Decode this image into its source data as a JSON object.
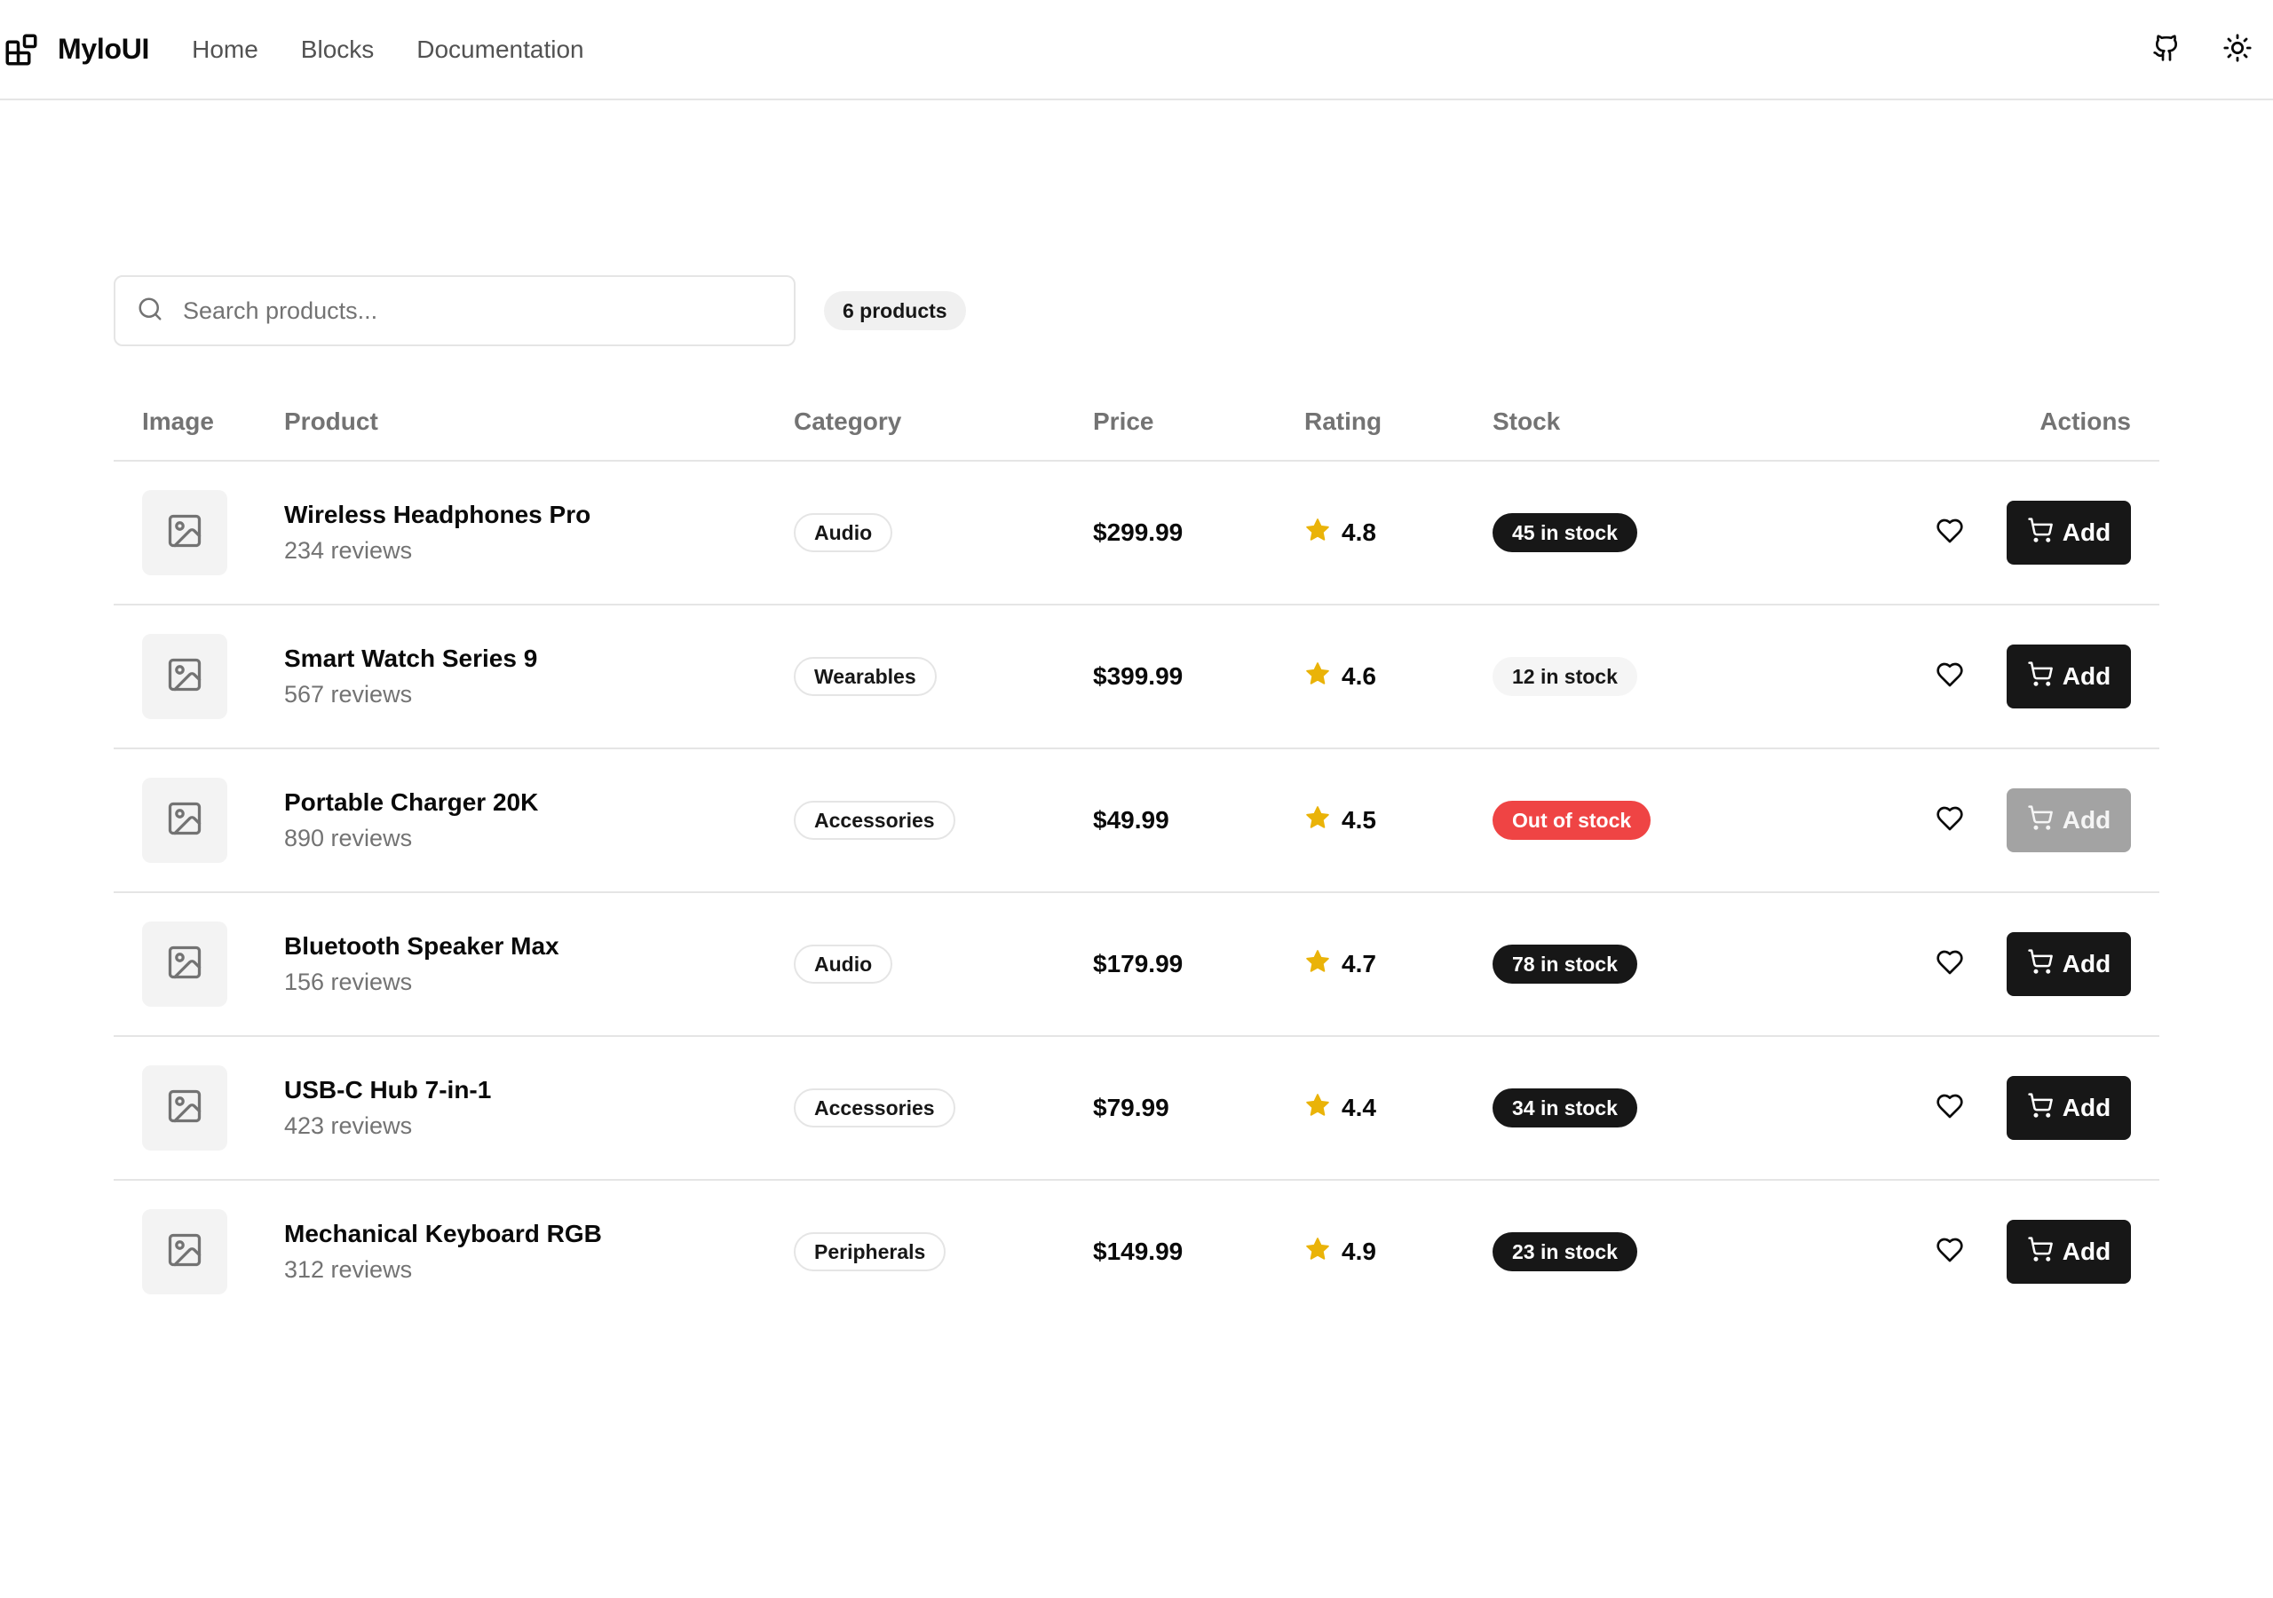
{
  "app": {
    "logo_text": "MyloUI",
    "logo_icon": "blocks-icon",
    "nav": [
      {
        "label": "Home"
      },
      {
        "label": "Blocks"
      },
      {
        "label": "Documentation"
      }
    ],
    "header_icons": [
      "github-icon",
      "sun-icon"
    ]
  },
  "toolbar": {
    "search_placeholder": "Search products...",
    "search_value": "",
    "product_count": "6 products"
  },
  "table": {
    "columns": {
      "image": "Image",
      "product": "Product",
      "category": "Category",
      "price": "Price",
      "rating": "Rating",
      "stock": "Stock",
      "actions": "Actions"
    },
    "rows": [
      {
        "name": "Wireless Headphones Pro",
        "reviews": "234 reviews",
        "category": "Audio",
        "price": "$299.99",
        "rating": "4.8",
        "stock": "45 in stock",
        "stock_status": "in",
        "add_label": "Add",
        "add_enabled": true
      },
      {
        "name": "Smart Watch Series 9",
        "reviews": "567 reviews",
        "category": "Wearables",
        "price": "$399.99",
        "rating": "4.6",
        "stock": "12 in stock",
        "stock_status": "low",
        "add_label": "Add",
        "add_enabled": true
      },
      {
        "name": "Portable Charger 20K",
        "reviews": "890 reviews",
        "category": "Accessories",
        "price": "$49.99",
        "rating": "4.5",
        "stock": "Out of stock",
        "stock_status": "out",
        "add_label": "Add",
        "add_enabled": false
      },
      {
        "name": "Bluetooth Speaker Max",
        "reviews": "156 reviews",
        "category": "Audio",
        "price": "$179.99",
        "rating": "4.7",
        "stock": "78 in stock",
        "stock_status": "in",
        "add_label": "Add",
        "add_enabled": true
      },
      {
        "name": "USB-C Hub 7-in-1",
        "reviews": "423 reviews",
        "category": "Accessories",
        "price": "$79.99",
        "rating": "4.4",
        "stock": "34 in stock",
        "stock_status": "in",
        "add_label": "Add",
        "add_enabled": true
      },
      {
        "name": "Mechanical Keyboard RGB",
        "reviews": "312 reviews",
        "category": "Peripherals",
        "price": "$149.99",
        "rating": "4.9",
        "stock": "23 in stock",
        "stock_status": "in",
        "add_label": "Add",
        "add_enabled": true
      }
    ]
  },
  "colors": {
    "primary": "#171717",
    "border": "#e5e5e5",
    "muted_text": "#737373",
    "star": "#eab308",
    "danger": "#ef4444",
    "disabled": "#a3a3a3"
  }
}
